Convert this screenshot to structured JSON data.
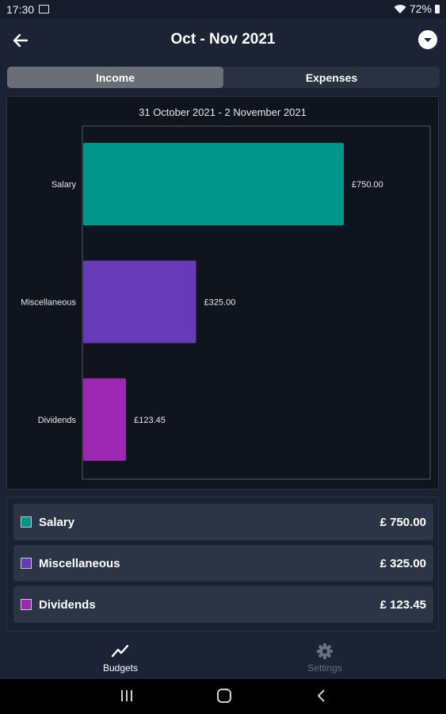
{
  "status_bar": {
    "time": "17:30",
    "battery": "72%"
  },
  "header": {
    "title": "Oct - Nov 2021",
    "back_icon": "arrow-left-icon",
    "menu_icon": "chevron-down-circle-icon"
  },
  "tabs": [
    {
      "label": "Income",
      "active": true
    },
    {
      "label": "Expenses",
      "active": false
    }
  ],
  "chart_data": {
    "type": "bar",
    "orientation": "horizontal",
    "title": "31 October 2021 - 2 November 2021",
    "categories": [
      "Salary",
      "Miscellaneous",
      "Dividends"
    ],
    "values": [
      750.0,
      325.0,
      123.45
    ],
    "value_labels": [
      "£750.00",
      "£325.00",
      "£123.45"
    ],
    "colors": [
      "#00968a",
      "#673ab7",
      "#9c27b0"
    ],
    "xlim": [
      0,
      750
    ],
    "grid": false,
    "legend": "below"
  },
  "legend": [
    {
      "label": "Salary",
      "value": "£ 750.00",
      "color": "#00968a"
    },
    {
      "label": "Miscellaneous",
      "value": "£ 325.00",
      "color": "#673ab7"
    },
    {
      "label": "Dividends",
      "value": "£ 123.45",
      "color": "#9c27b0"
    }
  ],
  "bottom_nav": [
    {
      "label": "Budgets",
      "icon": "trending-up-icon",
      "active": true
    },
    {
      "label": "Settings",
      "icon": "gear-icon",
      "active": false
    }
  ],
  "system_nav": {
    "recents_icon": "recents-icon",
    "home_icon": "home-icon",
    "back_icon": "back-icon"
  }
}
